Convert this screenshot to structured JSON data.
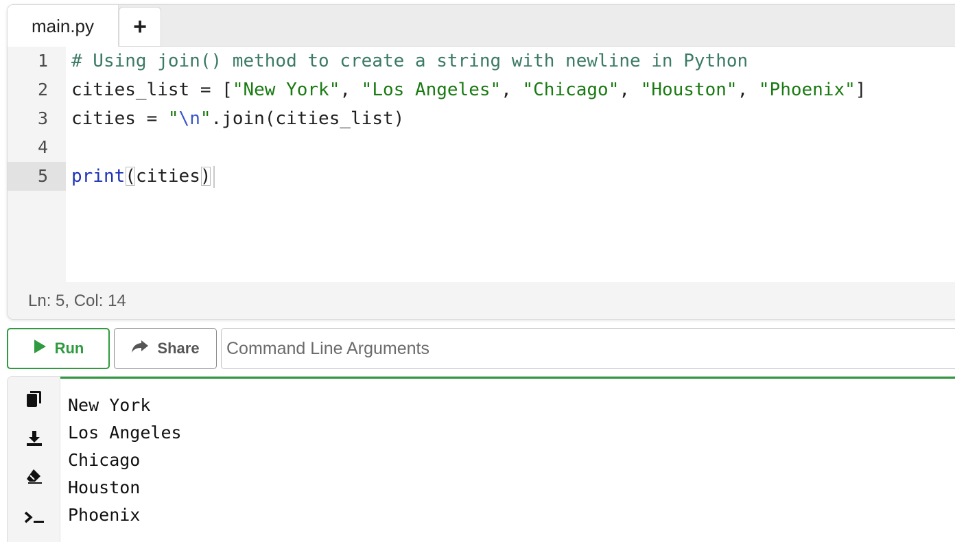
{
  "tabs": {
    "file_name": "main.py",
    "add_label": "+"
  },
  "editor": {
    "lines": [
      {
        "number": "1",
        "comment": "# Using join() method to create a string with newline in Python"
      },
      {
        "number": "2",
        "var": "cities_list",
        "assign": " = [",
        "items": [
          "\"New York\"",
          "\"Los Angeles\"",
          "\"Chicago\"",
          "\"Houston\"",
          "\"Phoenix\""
        ],
        "sep": ", ",
        "close": "]"
      },
      {
        "number": "3",
        "var": "cities",
        "assign": " = ",
        "str_open": "\"",
        "escape": "\\n",
        "str_close": "\"",
        "method": ".join(cities_list)"
      },
      {
        "number": "4"
      },
      {
        "number": "5",
        "keyword": "print",
        "open_paren": "(",
        "arg": "cities",
        "close_paren": ")"
      }
    ],
    "active_line": 5
  },
  "status": {
    "position": "Ln: 5,  Col: 14"
  },
  "toolbar": {
    "run_label": "Run",
    "share_label": "Share",
    "args_placeholder": "Command Line Arguments"
  },
  "output": {
    "lines": [
      "New York",
      "Los Angeles",
      "Chicago",
      "Houston",
      "Phoenix"
    ]
  },
  "colors": {
    "accent_green": "#2f9a3e",
    "comment": "#3b7a66",
    "string": "#1a7a12",
    "keyword": "#1d33b8"
  },
  "icons": {
    "run": "play-icon",
    "share": "share-arrow-icon",
    "copy": "copy-icon",
    "download": "download-icon",
    "clear": "eraser-icon",
    "terminal": "terminal-icon"
  }
}
